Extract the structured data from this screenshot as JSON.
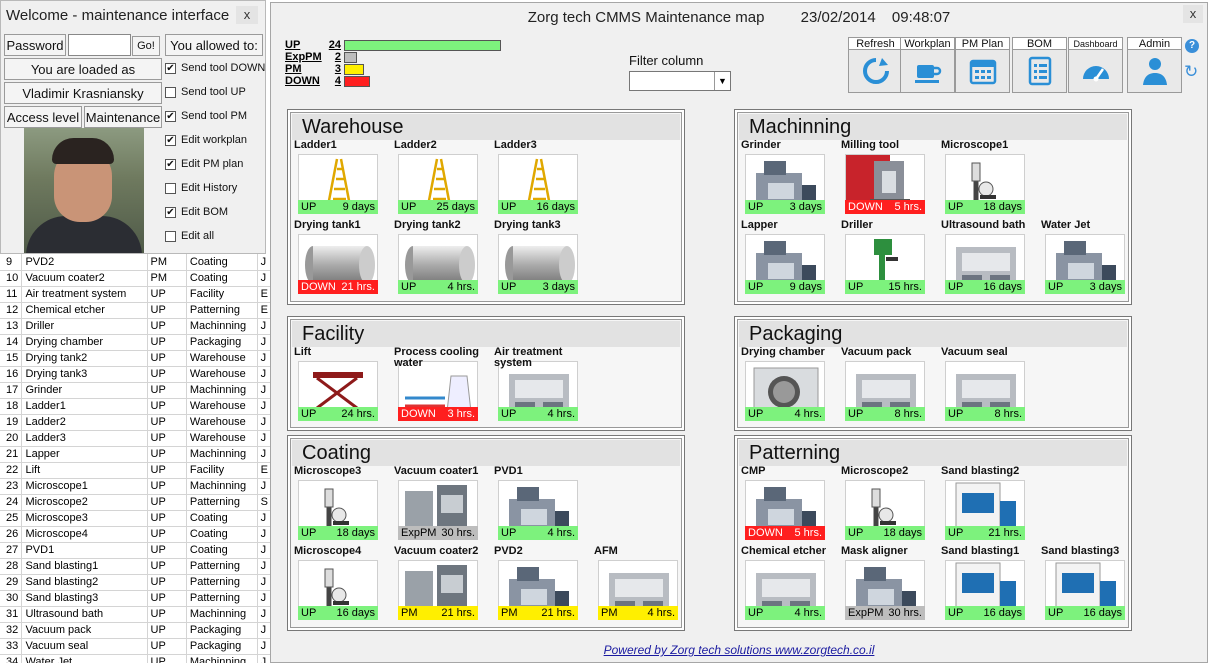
{
  "login": {
    "title": "Welcome - maintenance interface",
    "close_label": "x",
    "password_label": "Password",
    "go_label": "Go!",
    "loaded_label": "You are loaded as",
    "user_name": "Vladimir Krasniansky",
    "access_label": "Access level",
    "access_value": "Maintenance",
    "allowed_label": "You allowed to:",
    "permissions": [
      {
        "label": "Send tool DOWN",
        "checked": true
      },
      {
        "label": "Send tool UP",
        "checked": false
      },
      {
        "label": "Send tool PM",
        "checked": true
      },
      {
        "label": "Edit workplan",
        "checked": true
      },
      {
        "label": "Edit PM plan",
        "checked": true
      },
      {
        "label": "Edit History",
        "checked": false
      },
      {
        "label": "Edit BOM",
        "checked": true
      },
      {
        "label": "Edit all",
        "checked": false
      }
    ]
  },
  "sheet_rows": [
    [
      "9",
      "PVD2",
      "PM",
      "Coating",
      "J"
    ],
    [
      "10",
      "Vacuum coater2",
      "PM",
      "Coating",
      "J"
    ],
    [
      "11",
      "Air treatment system",
      "UP",
      "Facility",
      "E"
    ],
    [
      "12",
      "Chemical etcher",
      "UP",
      "Patterning",
      "E"
    ],
    [
      "13",
      "Driller",
      "UP",
      "Machinning",
      "J"
    ],
    [
      "14",
      "Drying chamber",
      "UP",
      "Packaging",
      "J"
    ],
    [
      "15",
      "Drying tank2",
      "UP",
      "Warehouse",
      "J"
    ],
    [
      "16",
      "Drying tank3",
      "UP",
      "Warehouse",
      "J"
    ],
    [
      "17",
      "Grinder",
      "UP",
      "Machinning",
      "J"
    ],
    [
      "18",
      "Ladder1",
      "UP",
      "Warehouse",
      "J"
    ],
    [
      "19",
      "Ladder2",
      "UP",
      "Warehouse",
      "J"
    ],
    [
      "20",
      "Ladder3",
      "UP",
      "Warehouse",
      "J"
    ],
    [
      "21",
      "Lapper",
      "UP",
      "Machinning",
      "J"
    ],
    [
      "22",
      "Lift",
      "UP",
      "Facility",
      "E"
    ],
    [
      "23",
      "Microscope1",
      "UP",
      "Machinning",
      "J"
    ],
    [
      "24",
      "Microscope2",
      "UP",
      "Patterning",
      "S"
    ],
    [
      "25",
      "Microscope3",
      "UP",
      "Coating",
      "J"
    ],
    [
      "26",
      "Microscope4",
      "UP",
      "Coating",
      "J"
    ],
    [
      "27",
      "PVD1",
      "UP",
      "Coating",
      "J"
    ],
    [
      "28",
      "Sand blasting1",
      "UP",
      "Patterning",
      "J"
    ],
    [
      "29",
      "Sand blasting2",
      "UP",
      "Patterning",
      "J"
    ],
    [
      "30",
      "Sand blasting3",
      "UP",
      "Patterning",
      "J"
    ],
    [
      "31",
      "Ultrasound bath",
      "UP",
      "Machinning",
      "J"
    ],
    [
      "32",
      "Vacuum pack",
      "UP",
      "Packaging",
      "J"
    ],
    [
      "33",
      "Vacuum seal",
      "UP",
      "Packaging",
      "J"
    ],
    [
      "34",
      "Water Jet",
      "UP",
      "Machinning",
      "J"
    ]
  ],
  "header": {
    "title": "Zorg tech CMMS Maintenance map",
    "date": "23/02/2014",
    "time": "09:48:07",
    "close_label": "x"
  },
  "legend": [
    {
      "label": "UP",
      "count": "24",
      "status": "UP",
      "fraction": 1.0
    },
    {
      "label": "ExpPM",
      "count": "2",
      "status": "ExpPM",
      "fraction": 0.08
    },
    {
      "label": "PM",
      "count": "3",
      "status": "PM",
      "fraction": 0.125
    },
    {
      "label": "DOWN",
      "count": "4",
      "status": "DOWN",
      "fraction": 0.167
    }
  ],
  "filter": {
    "label": "Filter column",
    "value": ""
  },
  "toolbar": [
    {
      "label": "Refresh",
      "icon": "refresh-icon"
    },
    {
      "label": "Workplan",
      "icon": "cup-icon"
    },
    {
      "label": "PM Plan",
      "icon": "calendar-icon"
    },
    {
      "label": "BOM",
      "icon": "list-icon"
    },
    {
      "label": "Dashboard",
      "icon": "gauge-icon"
    },
    {
      "label": "Admin",
      "icon": "user-icon"
    }
  ],
  "help_label": "?",
  "groups": [
    {
      "title": "Warehouse",
      "machines": [
        {
          "name": "Ladder1",
          "status": "UP",
          "time": "9 days",
          "pic": "ladder"
        },
        {
          "name": "Ladder2",
          "status": "UP",
          "time": "25 days",
          "pic": "ladder"
        },
        {
          "name": "Ladder3",
          "status": "UP",
          "time": "16 days",
          "pic": "ladder"
        },
        {
          "name": "Drying tank1",
          "status": "DOWN",
          "time": "21 hrs.",
          "pic": "tank"
        },
        {
          "name": "Drying tank2",
          "status": "UP",
          "time": "4 hrs.",
          "pic": "tank"
        },
        {
          "name": "Drying tank3",
          "status": "UP",
          "time": "3 days",
          "pic": "tank"
        }
      ]
    },
    {
      "title": "Machinning",
      "machines": [
        {
          "name": "Grinder",
          "status": "UP",
          "time": "3 days",
          "pic": "machine"
        },
        {
          "name": "Milling tool",
          "status": "DOWN",
          "time": "5 hrs.",
          "pic": "mill"
        },
        {
          "name": "Microscope1",
          "status": "UP",
          "time": "18 days",
          "pic": "scope"
        },
        {
          "name": "Lapper",
          "status": "UP",
          "time": "9 days",
          "pic": "machine"
        },
        {
          "name": "Driller",
          "status": "UP",
          "time": "15 hrs.",
          "pic": "drill"
        },
        {
          "name": "Ultrasound bath",
          "status": "UP",
          "time": "16 days",
          "pic": "box"
        },
        {
          "name": "Water Jet",
          "status": "UP",
          "time": "3 days",
          "pic": "machine"
        }
      ]
    },
    {
      "title": "Facility",
      "machines": [
        {
          "name": "Lift",
          "status": "UP",
          "time": "24 hrs.",
          "pic": "lift"
        },
        {
          "name": "Process cooling water",
          "status": "DOWN",
          "time": "3 hrs.",
          "pic": "cooling"
        },
        {
          "name": "Air treatment system",
          "status": "UP",
          "time": "4 hrs.",
          "pic": "box"
        }
      ]
    },
    {
      "title": "Packaging",
      "machines": [
        {
          "name": "Drying chamber",
          "status": "UP",
          "time": "4 hrs.",
          "pic": "chamber"
        },
        {
          "name": "Vacuum pack",
          "status": "UP",
          "time": "8 hrs.",
          "pic": "box"
        },
        {
          "name": "Vacuum seal",
          "status": "UP",
          "time": "8 hrs.",
          "pic": "box"
        }
      ]
    },
    {
      "title": "Coating",
      "machines": [
        {
          "name": "Microscope3",
          "status": "UP",
          "time": "18 days",
          "pic": "scope"
        },
        {
          "name": "Vacuum coater1",
          "status": "ExpPM",
          "time": "30 hrs.",
          "pic": "coater"
        },
        {
          "name": "PVD1",
          "status": "UP",
          "time": "4 hrs.",
          "pic": "machine"
        },
        {
          "name": "Microscope4",
          "status": "UP",
          "time": "16 days",
          "pic": "scope"
        },
        {
          "name": "Vacuum coater2",
          "status": "PM",
          "time": "21 hrs.",
          "pic": "coater"
        },
        {
          "name": "PVD2",
          "status": "PM",
          "time": "21 hrs.",
          "pic": "machine"
        },
        {
          "name": "AFM",
          "status": "PM",
          "time": "4 hrs.",
          "pic": "box"
        }
      ]
    },
    {
      "title": "Patterning",
      "machines": [
        {
          "name": "CMP",
          "status": "DOWN",
          "time": "5 hrs.",
          "pic": "machine"
        },
        {
          "name": "Microscope2",
          "status": "UP",
          "time": "18 days",
          "pic": "scope"
        },
        {
          "name": "Sand blasting2",
          "status": "UP",
          "time": "21 hrs.",
          "pic": "cabinet"
        },
        {
          "name": "Chemical etcher",
          "status": "UP",
          "time": "4 hrs.",
          "pic": "box"
        },
        {
          "name": "Mask aligner",
          "status": "ExpPM",
          "time": "30 hrs.",
          "pic": "machine"
        },
        {
          "name": "Sand blasting1",
          "status": "UP",
          "time": "16 days",
          "pic": "cabinet"
        },
        {
          "name": "Sand blasting3",
          "status": "UP",
          "time": "16 days",
          "pic": "cabinet"
        }
      ]
    }
  ],
  "footer": "Powered by Zorg tech solutions www.zorgtech.co.il",
  "colors": {
    "UP": "#7df27d",
    "DOWN": "#ff1f1f",
    "PM": "#ffef00",
    "ExpPM": "#bdbdbd",
    "accent": "#3a8fd9"
  }
}
